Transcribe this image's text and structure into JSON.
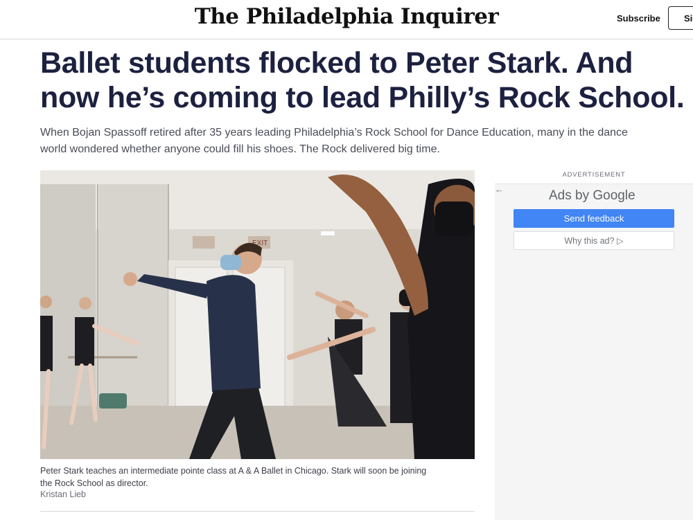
{
  "header": {
    "logo": "The Philadelphia Inquirer",
    "subscribe_label": "Subscribe",
    "signin_label": "Sign in"
  },
  "article": {
    "headline": "Ballet students flocked to Peter Stark. And now he’s coming to lead Philly’s Rock School.",
    "dek": "When Bojan Spassoff retired after 35 years leading Philadelphia’s Rock School for Dance Education, many in the dance\nworld wondered whether anyone could fill his shoes. The Rock delivered big time.",
    "photo": {
      "exit_sign": "EXIT",
      "caption": "Peter Stark teaches an intermediate pointe class at A & A Ballet in Chicago. Stark will soon be joining\nthe Rock School as director.",
      "credit": "Kristan Lieb"
    }
  },
  "ad": {
    "label": "ADVERTISEMENT",
    "back_icon": "←",
    "ads_by": "Ads by Google",
    "send_feedback": "Send feedback",
    "why_this_ad": "Why this ad? ▷"
  },
  "colors": {
    "headline": "#1d2140",
    "feedback_button": "#4285f4"
  }
}
